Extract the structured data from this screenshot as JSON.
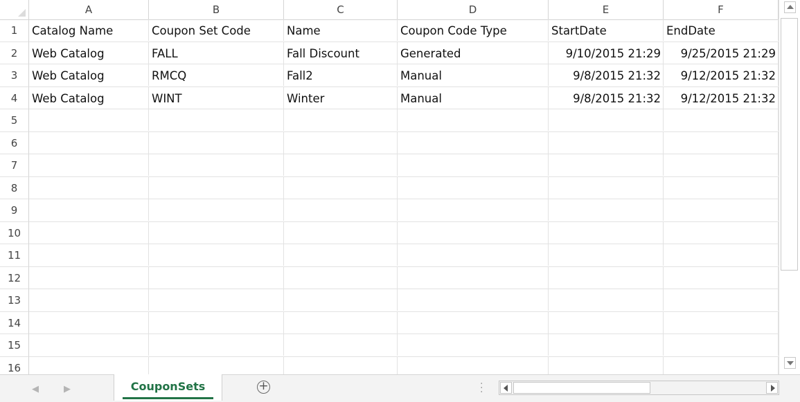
{
  "columns": [
    "A",
    "B",
    "C",
    "D",
    "E",
    "F"
  ],
  "row_numbers": [
    "1",
    "2",
    "3",
    "4",
    "5",
    "6",
    "7",
    "8",
    "9",
    "10",
    "11",
    "12",
    "13",
    "14",
    "15",
    "16"
  ],
  "rows": [
    [
      "Catalog Name",
      "Coupon Set Code",
      "Name",
      "Coupon Code Type",
      "StartDate",
      "EndDate"
    ],
    [
      "Web Catalog",
      "FALL",
      "Fall Discount",
      "Generated",
      "9/10/2015 21:29",
      "9/25/2015 21:29"
    ],
    [
      "Web Catalog",
      "RMCQ",
      "Fall2",
      "Manual",
      "9/8/2015 21:32",
      "9/12/2015 21:32"
    ],
    [
      "Web Catalog",
      "WINT",
      "Winter",
      "Manual",
      "9/8/2015 21:32",
      "9/12/2015 21:32"
    ]
  ],
  "sheet_tabs": [
    {
      "label": "CouponSets",
      "active": true
    }
  ],
  "add_sheet_symbol": "+",
  "colors": {
    "accent": "#217346",
    "gridline": "#e2e2e2",
    "header_text": "#444444"
  }
}
